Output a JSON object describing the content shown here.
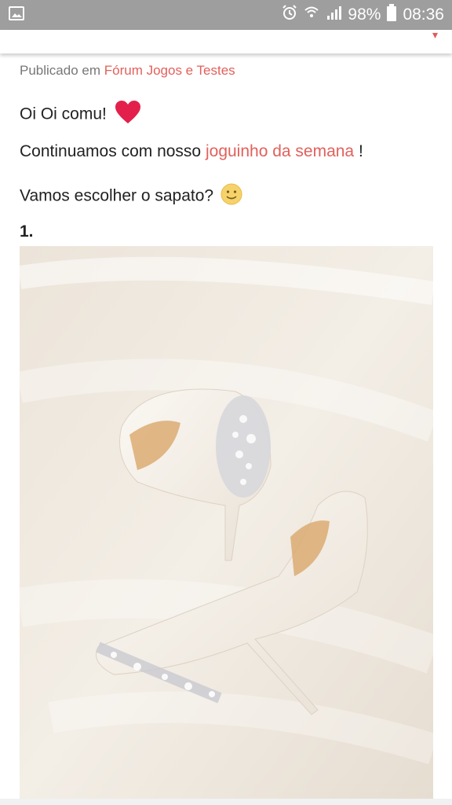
{
  "status": {
    "battery": "98%",
    "time": "08:36",
    "icons": [
      "image-icon",
      "alarm-icon",
      "wifi-icon",
      "signal-icon",
      "battery-icon"
    ]
  },
  "post": {
    "published_prefix": "Publicado em",
    "forum_link": "Fórum Jogos e Testes",
    "greeting": "Oi Oi comu!",
    "line2_prefix": "Continuamos com nosso",
    "line2_link": "joguinho da semana",
    "line2_suffix": "!",
    "line3": "Vamos escolher o sapato?",
    "item_number": "1."
  },
  "colors": {
    "link": "#e2605b",
    "status_bar": "#9e9e9e",
    "heart": "#e3204b"
  }
}
